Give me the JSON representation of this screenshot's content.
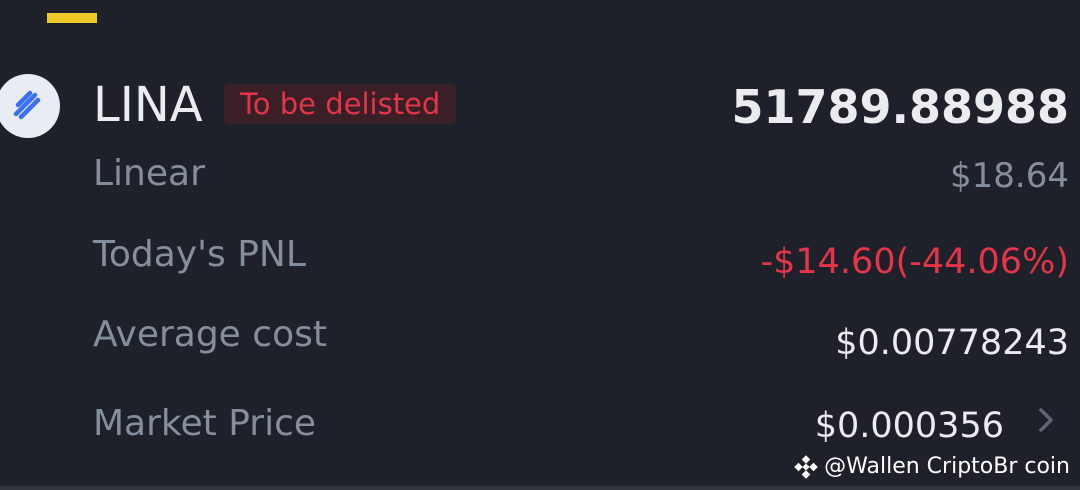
{
  "colors": {
    "background": "#1e2129",
    "accent": "#f0c929",
    "negative": "#e4344a",
    "muted": "#848e9c",
    "primary_text": "#eaecef"
  },
  "asset": {
    "symbol": "LINA",
    "badge": "To be delisted",
    "balance": "51789.88988",
    "name": "Linear",
    "usd_value": "$18.64",
    "logo_icon": "linear-logo-icon"
  },
  "rows": [
    {
      "label": "Today's PNL",
      "value": "-$14.60(-44.06%)"
    },
    {
      "label": "Average cost",
      "value": "$0.00778243"
    },
    {
      "label": "Market Price",
      "value": "$0.000356"
    }
  ],
  "watermark": "@Wallen CriptoBr coin"
}
